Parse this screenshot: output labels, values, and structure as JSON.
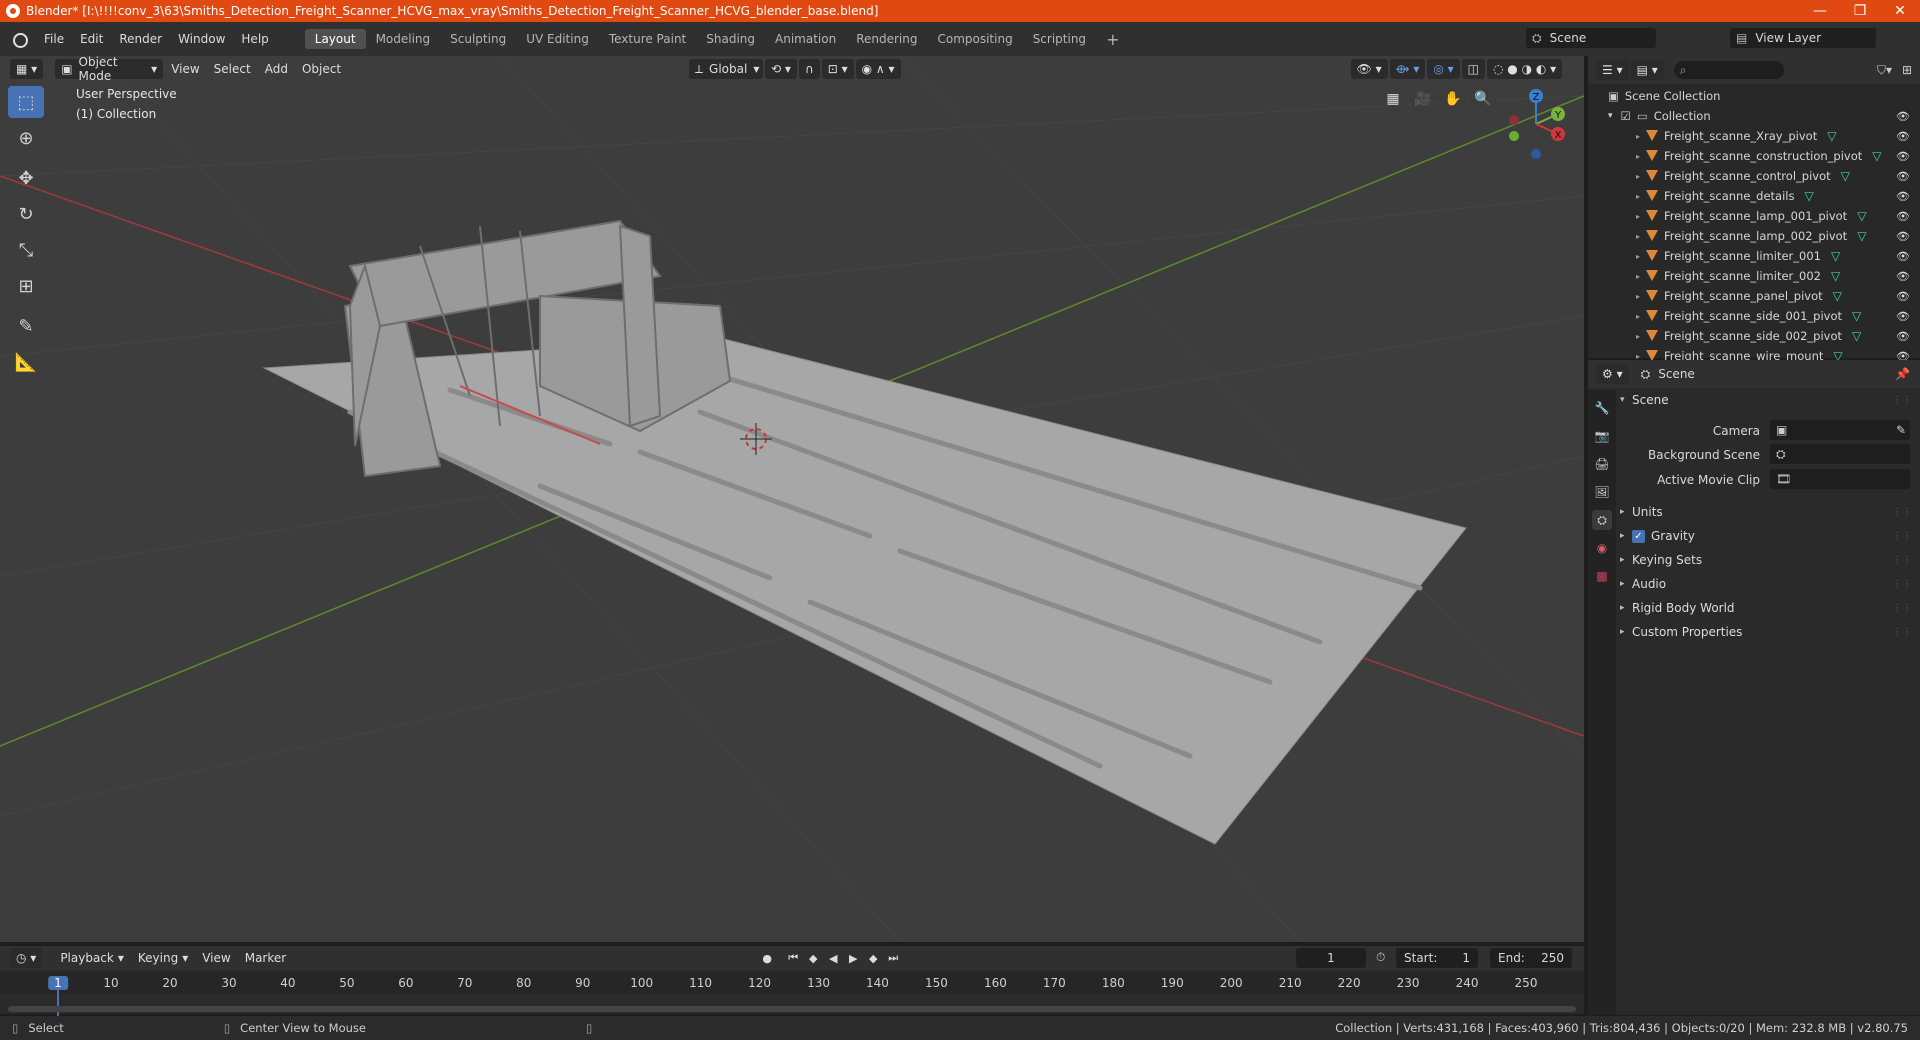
{
  "window": {
    "title": "Blender* [I:\\!!!!conv_3\\63\\Smiths_Detection_Freight_Scanner_HCVG_max_vray\\Smiths_Detection_Freight_Scanner_HCVG_blender_base.blend]",
    "minimize": "—",
    "maximize": "❐",
    "close": "✕"
  },
  "menu": [
    "File",
    "Edit",
    "Render",
    "Window",
    "Help"
  ],
  "workspaces": [
    "Layout",
    "Modeling",
    "Sculpting",
    "UV Editing",
    "Texture Paint",
    "Shading",
    "Animation",
    "Rendering",
    "Compositing",
    "Scripting"
  ],
  "active_workspace": "Layout",
  "scene_selector": "Scene",
  "view_layer": "View Layer",
  "viewport": {
    "mode": "Object Mode",
    "menus": [
      "View",
      "Select",
      "Add",
      "Object"
    ],
    "transform_orientation": "Global",
    "perspective_label": "User Perspective",
    "collection_label": "(1) Collection",
    "gizmo": {
      "x": "X",
      "y": "Y",
      "z": "Z"
    }
  },
  "outliner": {
    "search_placeholder": "",
    "scene_collection": "Scene Collection",
    "collection": "Collection",
    "items": [
      "Freight_scanne_Xray_pivot",
      "Freight_scanne_construction_pivot",
      "Freight_scanne_control_pivot",
      "Freight_scanne_details",
      "Freight_scanne_lamp_001_pivot",
      "Freight_scanne_lamp_002_pivot",
      "Freight_scanne_limiter_001",
      "Freight_scanne_limiter_002",
      "Freight_scanne_panel_pivot",
      "Freight_scanne_side_001_pivot",
      "Freight_scanne_side_002_pivot",
      "Freight_scanne_wire_mount"
    ]
  },
  "properties": {
    "context": "Scene",
    "panel_title": "Scene",
    "fields": {
      "camera_label": "Camera",
      "background_scene_label": "Background Scene",
      "active_movie_clip_label": "Active Movie Clip"
    },
    "subpanels": [
      "Units",
      "Gravity",
      "Keying Sets",
      "Audio",
      "Rigid Body World",
      "Custom Properties"
    ],
    "gravity_checked": true
  },
  "timeline": {
    "menus": [
      "Playback",
      "Keying",
      "View",
      "Marker"
    ],
    "current_frame": "1",
    "start_label": "Start:",
    "start_value": "1",
    "end_label": "End:",
    "end_value": "250",
    "ruler": [
      "1",
      "10",
      "20",
      "30",
      "40",
      "50",
      "60",
      "70",
      "80",
      "90",
      "100",
      "110",
      "120",
      "130",
      "140",
      "150",
      "160",
      "170",
      "180",
      "190",
      "200",
      "210",
      "220",
      "230",
      "240",
      "250"
    ]
  },
  "status": {
    "select": "Select",
    "center_view": "Center View to Mouse",
    "stats": "Collection | Verts:431,168 | Faces:403,960 | Tris:804,436 | Objects:0/20 | Mem: 232.8 MB | v2.80.75"
  }
}
